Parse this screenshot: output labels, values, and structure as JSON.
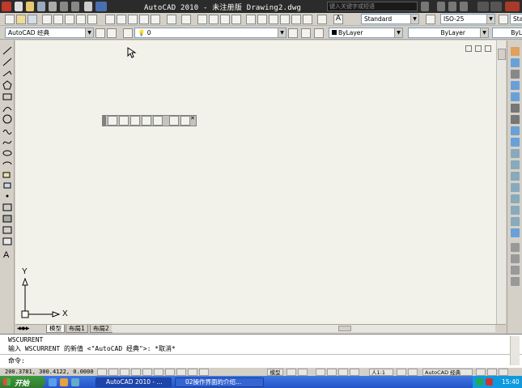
{
  "window": {
    "title": "AutoCAD 2010 - 未注册版   Drawing2.dwg"
  },
  "titlebar": {
    "search_placeholder": "键入关键字或短语"
  },
  "styles": {
    "text_style": "Standard",
    "dim_style": "ISO-25",
    "extra": "Sta"
  },
  "workspace": {
    "value": "AutoCAD 经典"
  },
  "layer": {
    "value": "0"
  },
  "properties": {
    "color": "ByLayer",
    "linetype": "ByLayer",
    "lineweight": "ByL"
  },
  "layout_tabs": [
    {
      "label": "模型"
    },
    {
      "label": "布局1"
    },
    {
      "label": "布局2"
    }
  ],
  "ucs": {
    "x": "X",
    "y": "Y"
  },
  "command": {
    "lines": [
      "WSCURRENT",
      "输入 WSCURRENT 的新值 <\"AutoCAD 经典\">: *取消*",
      "命令:"
    ]
  },
  "status": {
    "coords": "200.3781, 300.4122, 0.0000",
    "model": "模型",
    "scale": "人1:1",
    "workspace": "AutoCAD 经典"
  },
  "taskbar": {
    "start": "开始",
    "tasks": [
      "AutoCAD 2010 - ...",
      "02操作界面的介绍..."
    ],
    "time": "15:40"
  },
  "colors": {
    "titlebar": "#2b2b2b",
    "canvas": "#f2f2ea",
    "taskbar": "#2354c8",
    "start": "#2f7a2f"
  }
}
